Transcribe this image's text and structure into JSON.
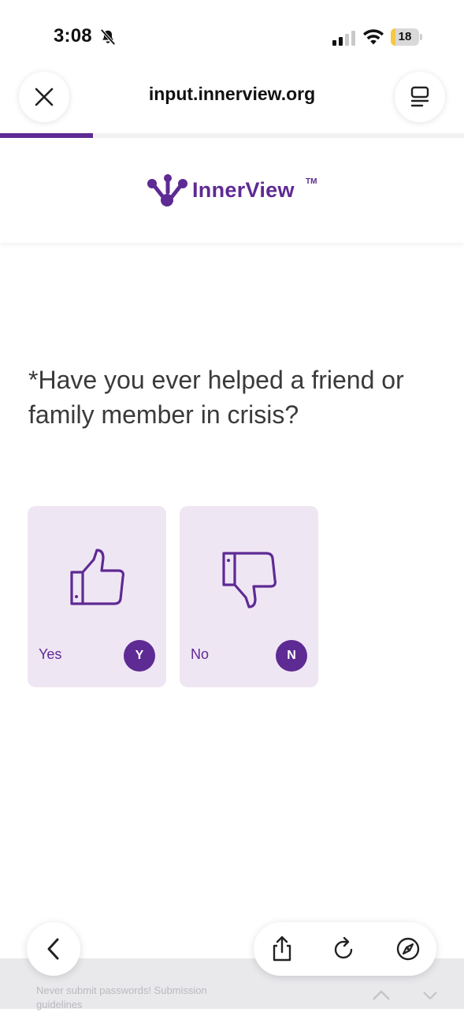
{
  "status_bar": {
    "time": "3:08",
    "battery_level": "18",
    "battery_fraction": 0.18,
    "icons": [
      "bell-slash-icon",
      "cellular-signal-icon",
      "wifi-icon",
      "battery-icon"
    ]
  },
  "browser": {
    "url": "input.innerview.org",
    "close_icon": "close-icon",
    "menu_icon": "reader-menu-icon",
    "progress_fraction": 0.2
  },
  "brand": {
    "name": "InnerView",
    "trademark": "TM",
    "color": "#5e2a93"
  },
  "question": {
    "text": "*Have you ever helped a friend or family member in crisis?"
  },
  "options": [
    {
      "label": "Yes",
      "key": "Y",
      "icon": "thumbs-up-icon"
    },
    {
      "label": "No",
      "key": "N",
      "icon": "thumbs-down-icon"
    }
  ],
  "colors": {
    "accent": "#5e2a93",
    "card_background": "#efe6f4",
    "question_text": "#3a3a3a"
  },
  "toolbar": {
    "back_icon": "chevron-left-icon",
    "share_icon": "share-icon",
    "reload_icon": "reload-icon",
    "compass_icon": "compass-icon"
  },
  "footer": {
    "notice": "Never submit passwords! Submission guidelines"
  }
}
